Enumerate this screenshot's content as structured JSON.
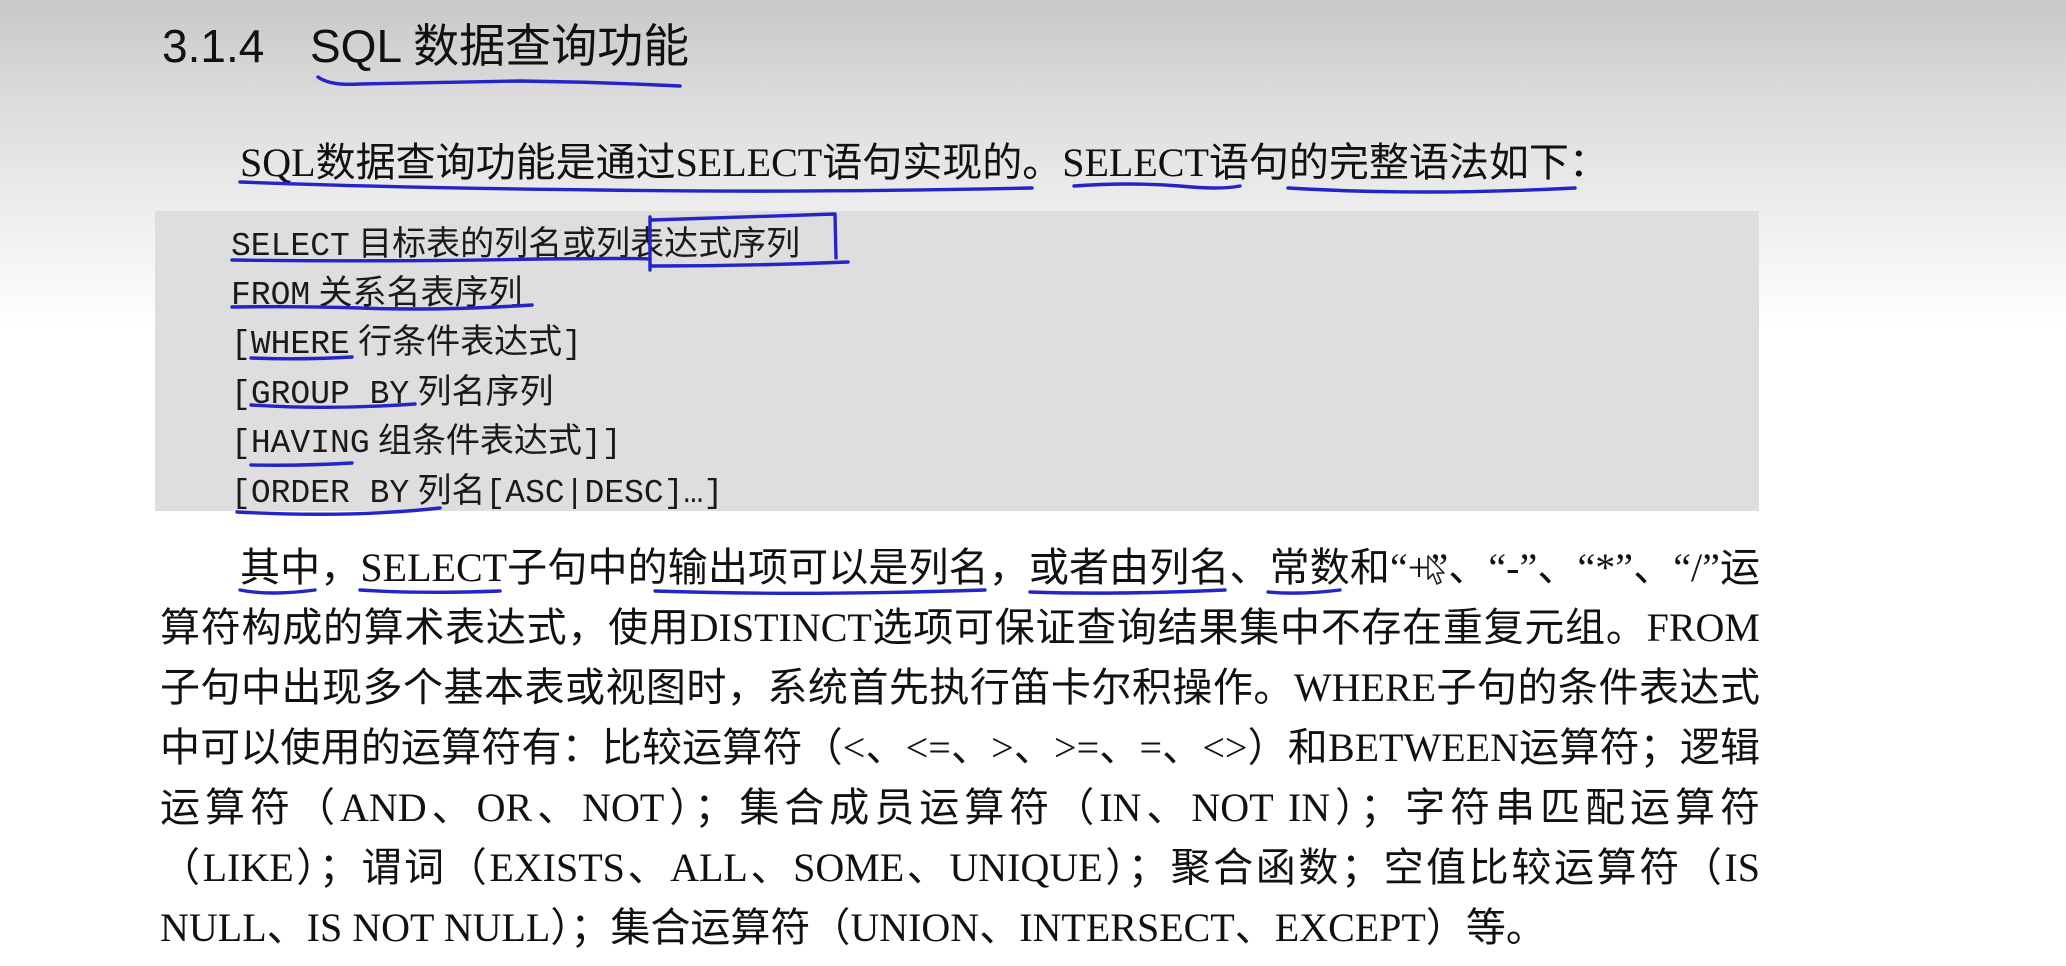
{
  "heading": {
    "number": "3.1.4",
    "title": "SQL 数据查询功能"
  },
  "intro": "SQL数据查询功能是通过SELECT语句实现的。SELECT语句的完整语法如下：",
  "syntax": [
    {
      "keyword": "SELECT",
      "prefix": "",
      "rest": "目标表的列名或列表达式序列",
      "suffix": ""
    },
    {
      "keyword": "FROM",
      "prefix": "",
      "rest": "关系名表序列",
      "suffix": ""
    },
    {
      "keyword": "WHERE",
      "prefix": "[",
      "rest": "行条件表达式",
      "suffix": "]"
    },
    {
      "keyword": "GROUP BY",
      "prefix": "[",
      "rest": "列名序列",
      "suffix": ""
    },
    {
      "keyword": "HAVING",
      "prefix": "[",
      "rest": "组条件表达式",
      "suffix": "]]"
    },
    {
      "keyword": "ORDER BY",
      "prefix": "[",
      "rest": "列名",
      "suffix": "[ASC|DESC]…]"
    }
  ],
  "paragraph": "其中，SELECT子句中的输出项可以是列名，或者由列名、常数和“+”、“-”、“*”、“/”运算符构成的算术表达式，使用DISTINCT选项可保证查询结果集中不存在重复元组。FROM子句中出现多个基本表或视图时，系统首先执行笛卡尔积操作。WHERE子句的条件表达式中可以使用的运算符有：比较运算符（<、<=、>、>=、=、<>）和BETWEEN运算符；逻辑运算符（AND、OR、NOT）；集合成员运算符（IN、NOT IN）；字符串匹配运算符（LIKE）；谓词（EXISTS、ALL、SOME、UNIQUE）；聚合函数；空值比较运算符（IS NULL、IS NOT NULL）；集合运算符（UNION、INTERSECT、EXCEPT）等。",
  "colors": {
    "annotation_ink": "#2424c8",
    "code_background": "#dedede"
  },
  "icons": {
    "cursor": "move-cursor-icon"
  }
}
